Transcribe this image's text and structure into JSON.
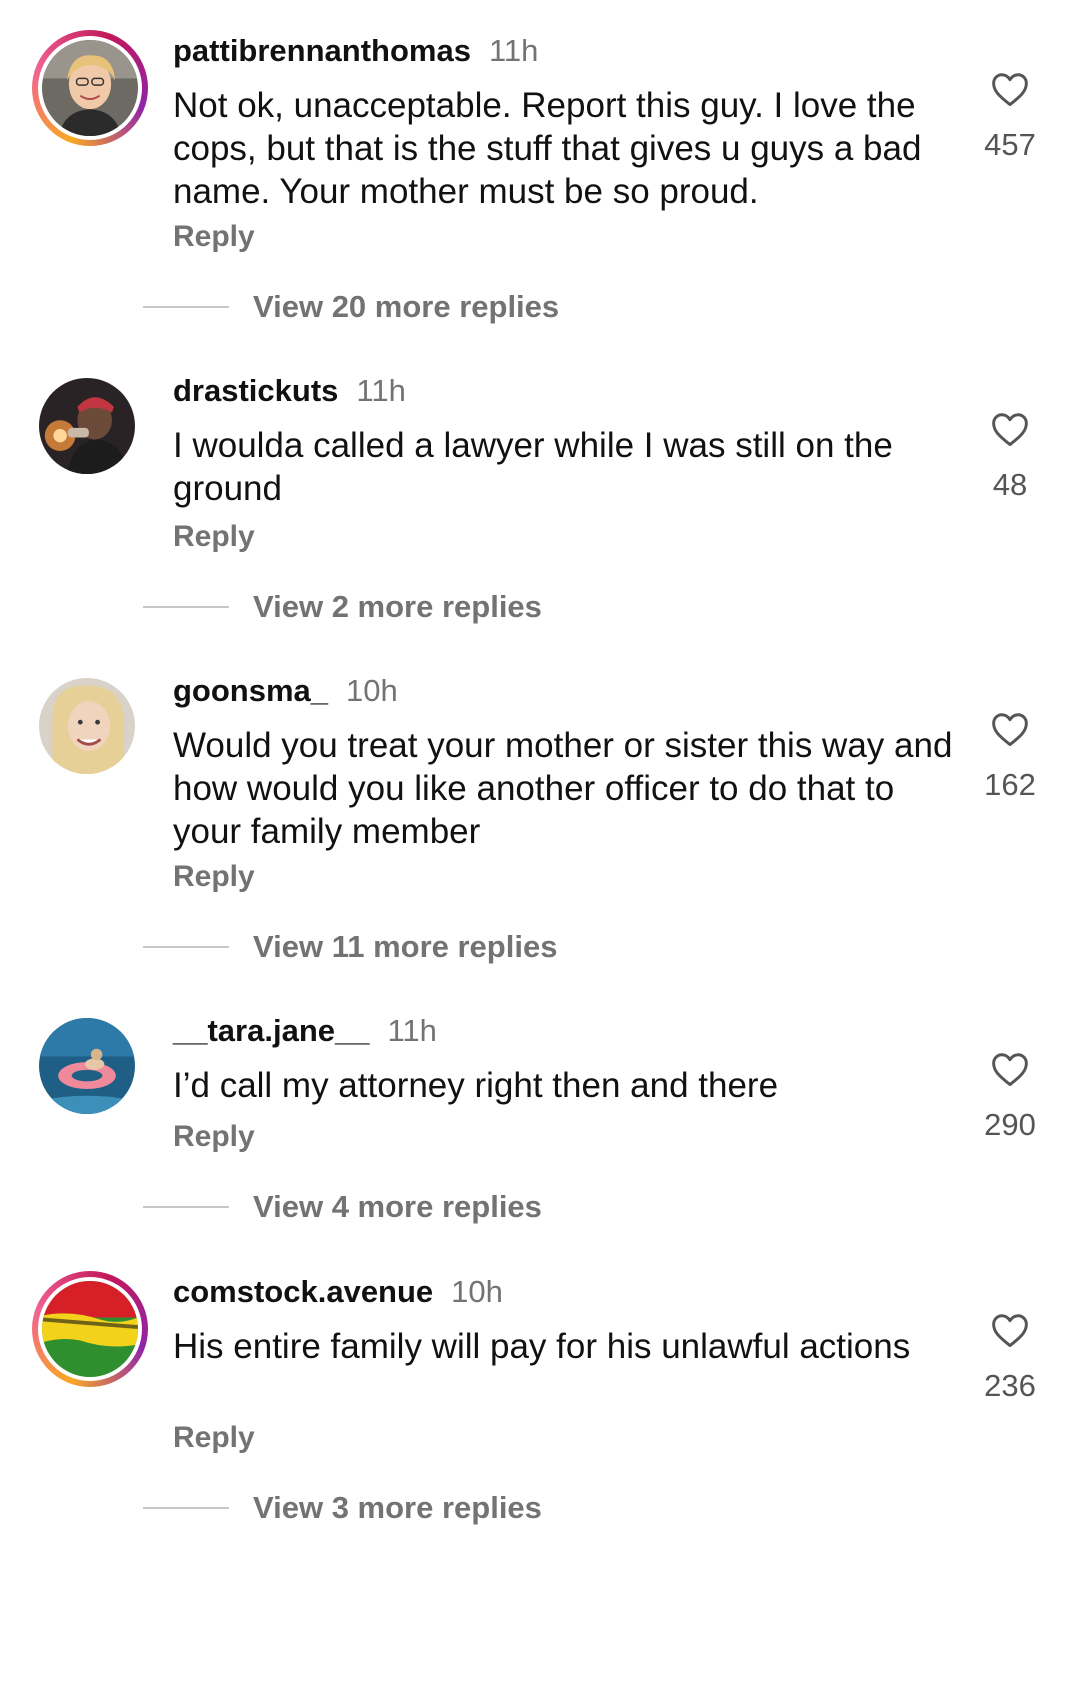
{
  "comments": [
    {
      "username": "pattibrennanthomas",
      "time": "11h",
      "text": "Not ok, unacceptable. Report this guy. I love the cops, but that is the stuff that gives u guys a bad name. Your mother must be so proud.",
      "reply_label": "Reply",
      "likes": "457",
      "view_replies": "View 20 more replies",
      "has_story_ring": true
    },
    {
      "username": "drastickuts",
      "time": "11h",
      "text": "I woulda called a lawyer while I was still on the ground",
      "reply_label": "Reply",
      "likes": "48",
      "view_replies": "View 2 more replies",
      "has_story_ring": false
    },
    {
      "username": "goonsma_",
      "time": "10h",
      "text": "Would you treat your mother or sister this way and how would you like another officer to do that to your family member",
      "reply_label": "Reply",
      "likes": "162",
      "view_replies": "View 11 more replies",
      "has_story_ring": false
    },
    {
      "username": "__tara.jane__",
      "time": "11h",
      "text": "I’d call my attorney right then and there",
      "reply_label": "Reply",
      "likes": "290",
      "view_replies": "View 4 more replies",
      "has_story_ring": false
    },
    {
      "username": "comstock.avenue",
      "time": "10h",
      "text": "His entire family will pay for his unlawful actions",
      "reply_label": "Reply",
      "likes": "236",
      "view_replies": "View 3 more replies",
      "has_story_ring": true
    }
  ],
  "icons": {
    "like": "heart-outline-icon"
  },
  "colors": {
    "text_primary": "#111111",
    "text_secondary": "#737373",
    "story_ring": [
      "#f9a825",
      "#f06292",
      "#8e24aa"
    ]
  }
}
